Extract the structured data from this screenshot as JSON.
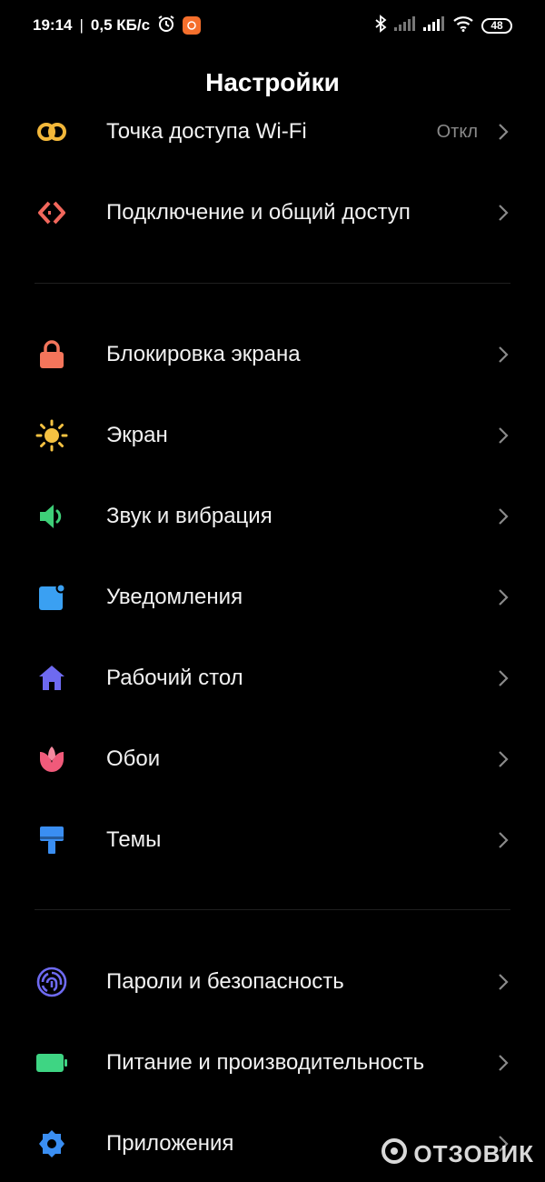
{
  "status_bar": {
    "time": "19:14",
    "separator": "|",
    "net_speed": "0,5 КБ/с",
    "battery_level": "48"
  },
  "page": {
    "title": "Настройки"
  },
  "colors": {
    "hotspot": "#f2b73a",
    "connection": "#f2675c",
    "lock": "#f4755b",
    "display": "#f5c242",
    "sound": "#3ecf78",
    "notifications": "#3aa0f2",
    "desktop": "#6e6af0",
    "wallpaper": "#f05a7a",
    "themes": "#3a8ef2",
    "passwords": "#6e6af0",
    "battery": "#3ed583",
    "apps": "#3a8ef2"
  },
  "sections": [
    {
      "items": [
        {
          "label": "Точка доступа Wi-Fi",
          "value": "Откл",
          "icon": "hotspot-icon"
        },
        {
          "label": "Подключение и общий доступ",
          "icon": "connection-share-icon"
        }
      ]
    },
    {
      "items": [
        {
          "label": "Блокировка экрана",
          "icon": "lock-icon"
        },
        {
          "label": "Экран",
          "icon": "sun-icon"
        },
        {
          "label": "Звук и вибрация",
          "icon": "speaker-icon"
        },
        {
          "label": "Уведомления",
          "icon": "notification-icon"
        },
        {
          "label": "Рабочий стол",
          "icon": "home-icon"
        },
        {
          "label": "Обои",
          "icon": "tulip-icon"
        },
        {
          "label": "Темы",
          "icon": "paint-brush-icon"
        }
      ]
    },
    {
      "items": [
        {
          "label": "Пароли и безопасность",
          "icon": "fingerprint-icon"
        },
        {
          "label": "Питание и производительность",
          "icon": "battery-icon"
        },
        {
          "label": "Приложения",
          "icon": "gear-icon"
        }
      ]
    }
  ],
  "watermark": {
    "text": "ОТЗОВИК"
  }
}
